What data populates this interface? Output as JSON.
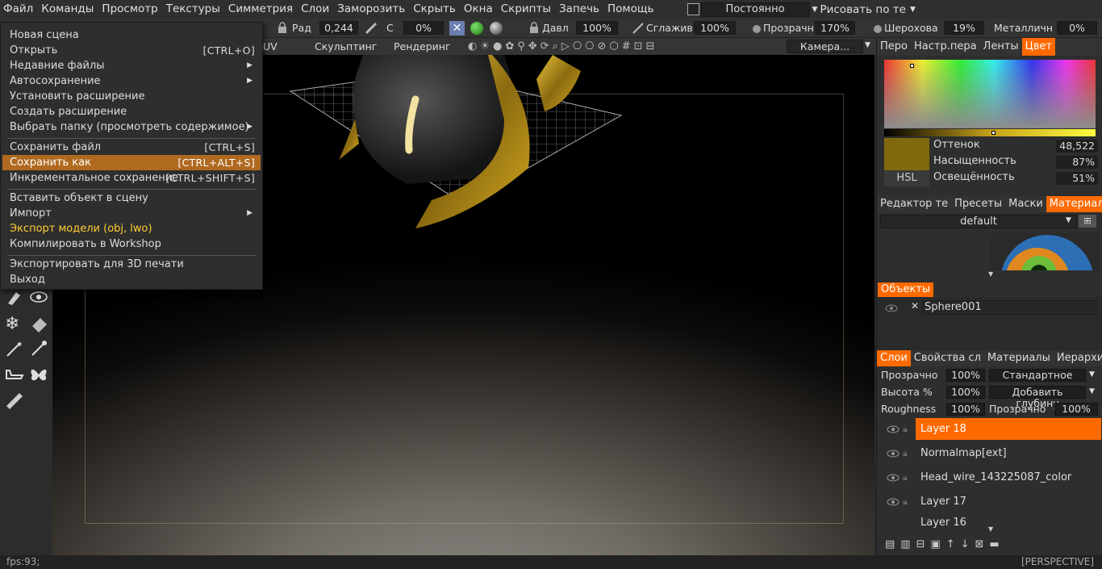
{
  "menubar": {
    "items": [
      "Файл",
      "Команды",
      "Просмотр",
      "Текстуры",
      "Симметрия",
      "Слои",
      "Заморозить",
      "Скрыть",
      "Окна",
      "Скрипты",
      "Запечь",
      "Помощь"
    ],
    "mode_value": "Постоянно",
    "draw_mode": "Рисовать по те"
  },
  "toolbar": {
    "radius_label": "Рад",
    "radius_value": "0,244",
    "c_label": "С",
    "c_value": "0%",
    "pressure_label": "Давл",
    "pressure_value": "100%",
    "smooth_label": "Сглажив",
    "smooth_value": "100%",
    "opacity_label": "Прозрачн",
    "opacity_value": "170%",
    "rough_label": "Шерохова",
    "rough_value": "19%",
    "metal_label": "Металличн",
    "metal_value": "0%"
  },
  "room_tabs": {
    "uv": "UV",
    "sculpt": "Скульптинг",
    "render": "Рендеринг",
    "camera": "Камера..."
  },
  "file_menu": {
    "items": [
      {
        "label": "Новая сцена",
        "shortcut": ""
      },
      {
        "label": "Открыть",
        "shortcut": "[CTRL+O]"
      },
      {
        "label": "Недавние файлы",
        "shortcut": ""
      },
      {
        "label": "Автосохранение",
        "shortcut": ""
      },
      {
        "label": "Установить расширение",
        "shortcut": ""
      },
      {
        "label": "Создать расширение",
        "shortcut": ""
      },
      {
        "label": "Выбрать папку (просмотреть содержимое)",
        "shortcut": ""
      },
      {
        "label": "Сохранить файл",
        "shortcut": "[CTRL+S]"
      },
      {
        "label": "Сохранить как",
        "shortcut": "[CTRL+ALT+S]"
      },
      {
        "label": "Инкрементальное сохранение",
        "shortcut": "[CTRL+SHIFT+S]"
      },
      {
        "label": "Вставить объект в сцену",
        "shortcut": ""
      },
      {
        "label": "Импорт",
        "shortcut": ""
      },
      {
        "label": "Экспорт модели (obj, lwo)",
        "shortcut": ""
      },
      {
        "label": "Компилировать в Workshop",
        "shortcut": ""
      },
      {
        "label": "Экспортировать для 3D печати",
        "shortcut": ""
      },
      {
        "label": "Выход",
        "shortcut": ""
      }
    ]
  },
  "color_panel": {
    "tabs": [
      "Перо",
      "Настр.пера",
      "Ленты",
      "Цвет"
    ],
    "hue_label": "Оттенок",
    "hue_value": "48,522",
    "sat_label": "Насыщенность",
    "sat_value": "87%",
    "light_label": "Освещённость",
    "light_value": "51%",
    "mode": "HSL",
    "swatch_color": "#82690f"
  },
  "materials_panel": {
    "tabs": [
      "Редактор те",
      "Пресеты",
      "Маски",
      "Материалы"
    ],
    "preset": "default"
  },
  "objects_panel": {
    "title": "Объекты",
    "object": "Sphere001"
  },
  "layers_panel": {
    "tabs": [
      "Слои",
      "Свойства сл",
      "Материалы",
      "Иерархия"
    ],
    "opacity_label": "Прозрачно",
    "opacity_value": "100%",
    "blend": "Стандартное",
    "height_label": "Высота %",
    "height_value": "100%",
    "depth_mode": "Добавить глубину",
    "rough_label": "Roughness",
    "rough_value": "100%",
    "metal_label": "Прозрачно",
    "metal_value": "100%",
    "layers": [
      "Layer  18",
      "Normalmap[ext]",
      "Head_wire_143225087_color",
      "Layer  17",
      "Layer  16"
    ]
  },
  "status": {
    "fps": "fps:93;",
    "view": "[PERSPECTIVE]"
  },
  "accent": "#ff6a00"
}
